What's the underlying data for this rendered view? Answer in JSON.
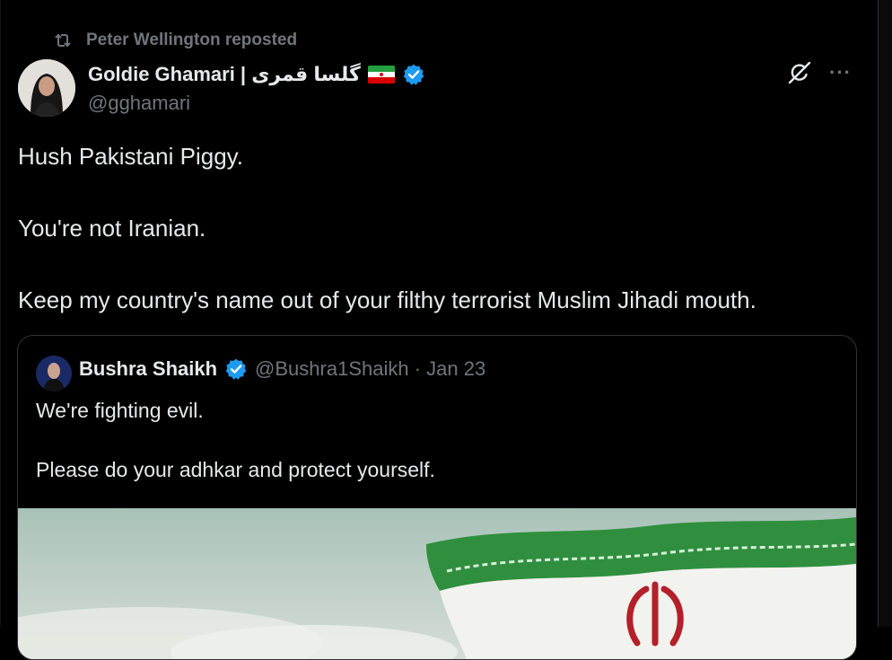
{
  "repost": {
    "label": "Peter Wellington reposted"
  },
  "author": {
    "display_name": "Goldie Ghamari | گلسا قمری",
    "handle": "@gghamari"
  },
  "post": {
    "paragraphs": [
      "Hush Pakistani Piggy.",
      "You're not Iranian.",
      "Keep my country's name out of your filthy terrorist Muslim Jihadi mouth."
    ]
  },
  "quote": {
    "display_name": "Bushra Shaikh",
    "meta": "@Bushra1Shaikh · Jan 23",
    "paragraphs": [
      "We're fighting evil.",
      "Please do your adhkar and protect yourself."
    ]
  },
  "icons": {
    "repost": "repost-icon",
    "verified": "verified-badge-icon",
    "flag": "iran-flag-emoji",
    "grok": "grok-icon",
    "more": "more-options-icon"
  },
  "colors": {
    "background": "#000000",
    "text_primary": "#e7e9ea",
    "text_secondary": "#71767b",
    "verified_blue": "#1d9bf0",
    "border": "#2f3336"
  }
}
